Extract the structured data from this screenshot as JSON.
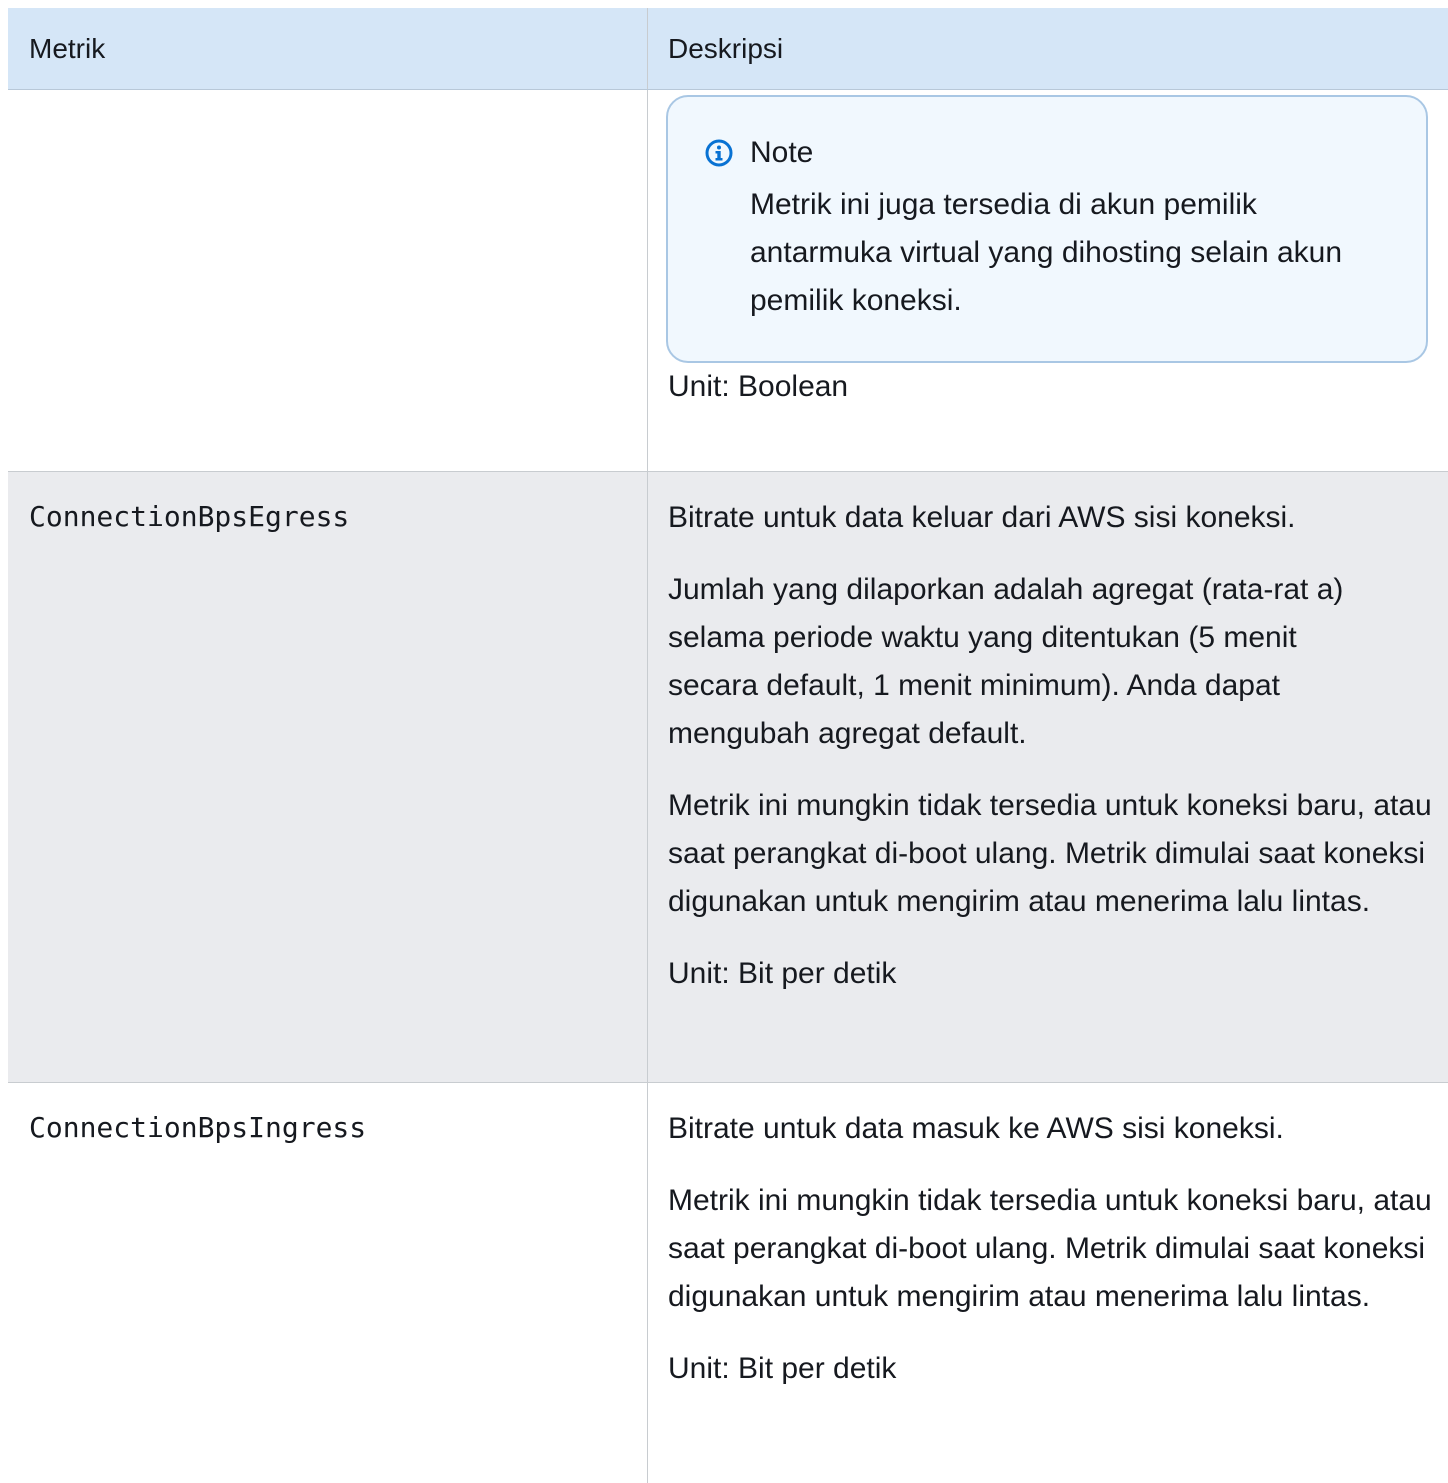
{
  "table": {
    "headers": [
      "Metrik",
      "Deskripsi"
    ],
    "rows": [
      {
        "metric": "",
        "note": {
          "title": "Note",
          "text": "Metrik ini juga tersedia di akun pemilik antarmuka virtual yang dihosting selain akun pemilik koneksi."
        },
        "unit": "Unit: Boolean"
      },
      {
        "metric": "ConnectionBpsEgress",
        "paragraphs": [
          "Bitrate untuk data keluar dari AWS sisi koneksi.",
          "Jumlah yang dilaporkan adalah agregat (rata-rat a) selama periode waktu yang ditentukan (5 menit secara default, 1 menit minimum). Anda dapat mengubah agregat default.",
          "Metrik ini mungkin tidak tersedia untuk koneksi baru, atau saat perangkat di-boot ulang. Metrik dimulai saat koneksi digunakan untuk mengirim atau menerima lalu lintas.",
          "Unit: Bit per detik"
        ]
      },
      {
        "metric": "ConnectionBpsIngress",
        "paragraphs": [
          "Bitrate untuk data masuk ke AWS sisi koneksi.",
          "Metrik ini mungkin tidak tersedia untuk koneksi baru, atau saat perangkat di-boot ulang. Metrik dimulai saat koneksi digunakan untuk mengirim atau menerima lalu lintas.",
          "Unit: Bit per detik"
        ]
      }
    ]
  },
  "colors": {
    "header_bg": "#d5e6f7",
    "shaded_row_bg": "#eaebee",
    "note_bg": "#f1f8fe",
    "note_border": "#a9c7e4",
    "info_icon": "#0972d3"
  },
  "icons": {
    "note_icon": "info-circle-icon"
  }
}
